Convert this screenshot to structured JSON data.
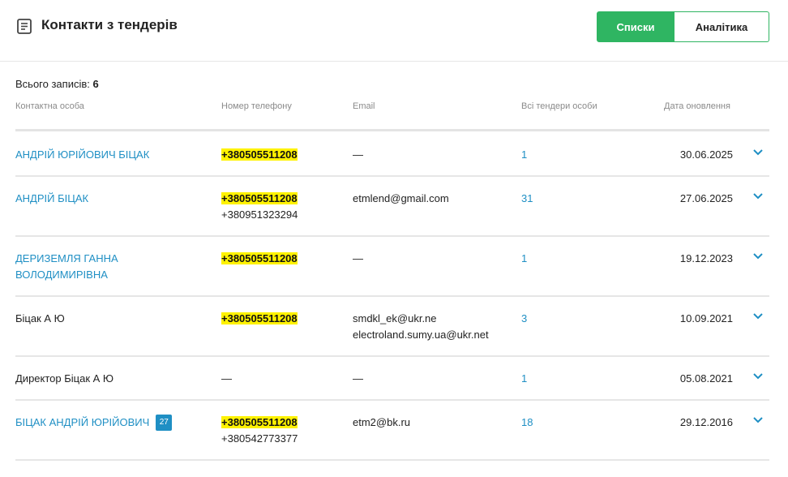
{
  "header": {
    "title": "Контакти з тендерів",
    "icon": "document-list-icon",
    "toggle": {
      "active_label": "Списки",
      "inactive_label": "Аналітика"
    }
  },
  "summary": {
    "label": "Всього записів:",
    "count": "6"
  },
  "columns": {
    "contact": "Контактна особа",
    "phone": "Номер телефону",
    "email": "Email",
    "tenders": "Всі тендери особи",
    "date": "Дата оновлення"
  },
  "colors": {
    "accent": "#2fb562",
    "link": "#1f8fc4",
    "highlight": "#fff200"
  },
  "rows": [
    {
      "name_line1": "АНДРІЙ ЮРІЙОВИЧ БІЦАК",
      "name_line2": "",
      "badge": "",
      "phone_primary": "+380505511208",
      "phone_secondary": "",
      "email_1": "—",
      "email_2": "",
      "tenders": "1",
      "date": "30.06.2025"
    },
    {
      "name_line1": "АНДРІЙ БІЦАК",
      "name_line2": "",
      "badge": "",
      "phone_primary": "+380505511208",
      "phone_secondary": "+380951323294",
      "email_1": "etmlend@gmail.com",
      "email_2": "",
      "tenders": "31",
      "date": "27.06.2025"
    },
    {
      "name_line1": "ДЕРИЗЕМЛЯ ГАННА",
      "name_line2": "ВОЛОДИМИРІВНА",
      "badge": "",
      "phone_primary": "+380505511208",
      "phone_secondary": "",
      "email_1": "—",
      "email_2": "",
      "tenders": "1",
      "date": "19.12.2023"
    },
    {
      "name_line1": "Біцак А Ю",
      "name_line2": "",
      "badge": "",
      "phone_primary": "+380505511208",
      "phone_secondary": "",
      "email_1": "smdkl_ek@ukr.ne",
      "email_2": "electroland.sumy.ua@ukr.net",
      "tenders": "3",
      "date": "10.09.2021"
    },
    {
      "name_line1": "Директор Біцак А Ю",
      "name_line2": "",
      "badge": "",
      "phone_primary": "",
      "phone_secondary": "—",
      "email_1": "—",
      "email_2": "",
      "tenders": "1",
      "date": "05.08.2021"
    },
    {
      "name_line1": "БІЦАК АНДРІЙ ЮРІЙОВИЧ",
      "name_line2": "",
      "badge": "27",
      "phone_primary": "+380505511208",
      "phone_secondary": "+380542773377",
      "email_1": "etm2@bk.ru",
      "email_2": "",
      "tenders": "18",
      "date": "29.12.2016"
    }
  ]
}
